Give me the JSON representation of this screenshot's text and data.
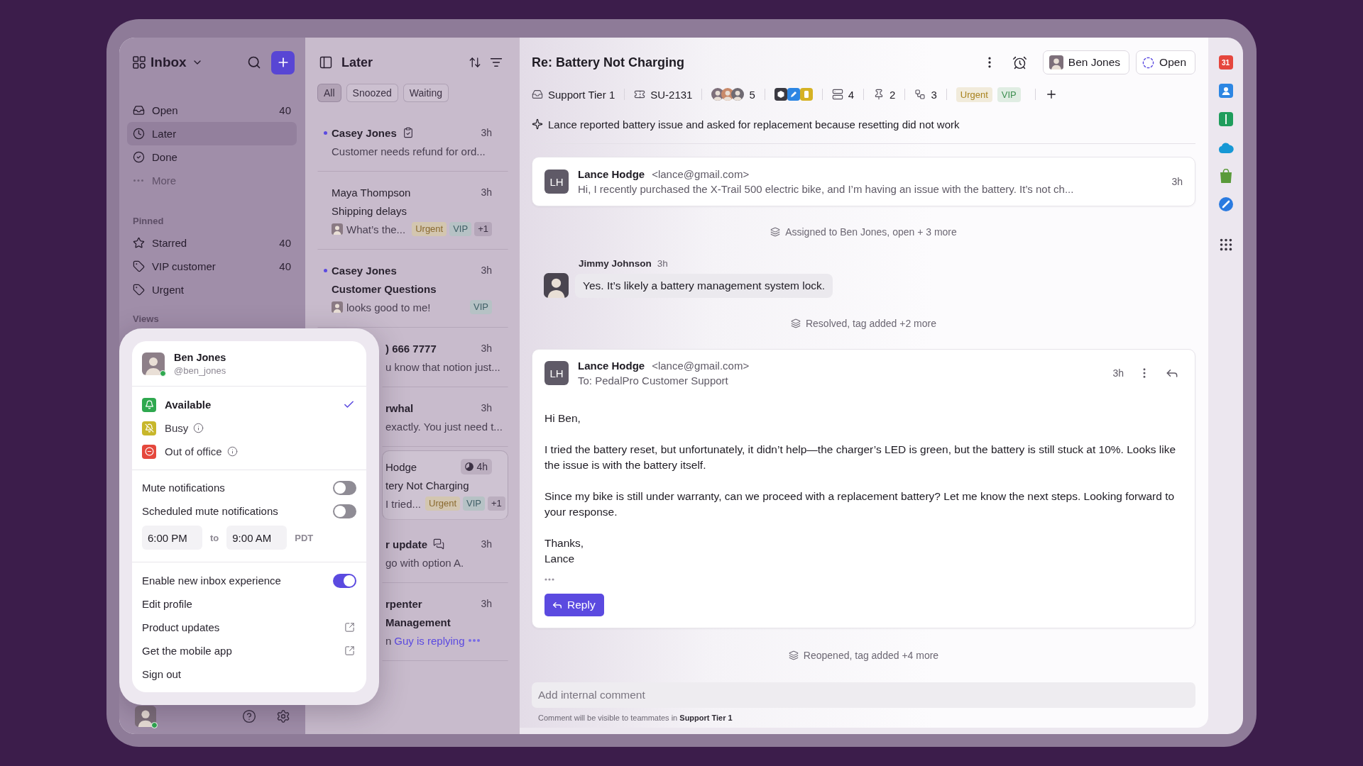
{
  "sidebar": {
    "title": "Inbox",
    "nav": [
      {
        "label": "Open",
        "count": "40",
        "selected": false
      },
      {
        "label": "Later",
        "selected": true
      },
      {
        "label": "Done",
        "selected": false
      }
    ],
    "more": "More",
    "sections": [
      {
        "title": "Pinned",
        "items": [
          {
            "kind": "starred",
            "label": "Starred",
            "count": "40"
          },
          {
            "kind": "tag",
            "label": "VIP customer",
            "count": "40"
          },
          {
            "kind": "tag",
            "label": "Urgent"
          }
        ]
      },
      {
        "title": "Views"
      }
    ]
  },
  "list": {
    "title": "Later",
    "filters": [
      {
        "label": "All",
        "selected": true
      },
      {
        "label": "Snoozed",
        "selected": false
      },
      {
        "label": "Waiting",
        "selected": false
      }
    ],
    "conversations": [
      {
        "kind": "task",
        "name": "Casey Jones",
        "unread": true,
        "selected": false,
        "time": "3h",
        "preview_avatar": false,
        "preview": "Customer needs refund for ord..."
      },
      {
        "kind": "plain",
        "name": "Maya Thompson",
        "unread": false,
        "selected": false,
        "time": "3h",
        "subject": "Shipping delays",
        "preview_avatar": true,
        "preview": "What’s the...",
        "tags": [
          {
            "label": "Urgent",
            "color": "#8a6a2f"
          },
          {
            "label": "VIP",
            "color": "#3f5f66"
          }
        ],
        "more_tags": "+1"
      },
      {
        "kind": "plain",
        "name": "Casey Jones",
        "unread": true,
        "selected": false,
        "time": "3h",
        "subject": "Customer Questions",
        "preview_avatar": true,
        "preview": "looks good to me!",
        "tags": [
          {
            "label": "VIP",
            "color": "#3f5f66"
          }
        ]
      },
      {
        "kind": "plain",
        "name": ") 666 7777",
        "unread": true,
        "selected": false,
        "time": "3h",
        "preview_avatar": false,
        "preview": "u know that notion just..."
      },
      {
        "kind": "plain",
        "name": "rwhal",
        "unread": true,
        "selected": false,
        "time": "3h",
        "preview_avatar": false,
        "preview": "exactly. You just need t..."
      },
      {
        "kind": "timer",
        "name": "Hodge",
        "unread": false,
        "selected": true,
        "time": "4h",
        "subject": "tery Not Charging",
        "preview_avatar": false,
        "preview": "I tried...",
        "tags": [
          {
            "label": "Urgent",
            "color": "#8a6a2f"
          },
          {
            "label": "VIP",
            "color": "#3f5f66"
          }
        ],
        "more_tags": "+1"
      },
      {
        "kind": "chat",
        "name": "r update",
        "unread": true,
        "selected": false,
        "time": "3h",
        "preview_avatar": false,
        "preview": "go with option A."
      },
      {
        "kind": "plain",
        "name": "rpenter",
        "unread": true,
        "selected": false,
        "time": "3h",
        "subject": "Management",
        "preview_avatar": false,
        "preview": "n",
        "typing": "Guy is replying"
      }
    ]
  },
  "conversation": {
    "title": "Re: Battery Not Charging",
    "assignee": "Ben Jones",
    "status": "Open",
    "properties": [
      {
        "kind": "inbox",
        "label": "Support Tier 1"
      },
      {
        "kind": "ticket",
        "label": "SU-2131"
      },
      {
        "kind": "people",
        "label": "5"
      },
      {
        "kind": "apps"
      },
      {
        "kind": "records",
        "label": "4"
      },
      {
        "kind": "pins",
        "label": "2"
      },
      {
        "kind": "links",
        "label": "3"
      }
    ],
    "tags": [
      {
        "label": "Urgent",
        "color": "#a8821e"
      },
      {
        "label": "VIP",
        "color": "#3f8f52"
      }
    ],
    "summary": "Lance reported battery issue and asked for replacement because resetting did not work",
    "timeline": [
      {
        "kind": "email",
        "expanded": false,
        "initials": "LH",
        "name": "Lance Hodge",
        "email": "<lance@gmail.com>",
        "preview": "Hi, I recently purchased the X-Trail 500 electric bike, and I’m having an issue with the battery. It’s not ch...",
        "time": "3h"
      },
      {
        "kind": "event",
        "text": "Assigned to Ben Jones, open + 3 more"
      },
      {
        "kind": "comment",
        "name": "Jimmy Johnson",
        "time": "3h",
        "text": "Yes. It’s likely a battery management system lock."
      },
      {
        "kind": "event",
        "text": "Resolved, tag added +2 more"
      },
      {
        "kind": "email",
        "expanded": true,
        "initials": "LH",
        "name": "Lance Hodge",
        "email": "<lance@gmail.com>",
        "to": "To: PedalPro Customer Support",
        "time": "3h",
        "body": [
          [
            "Hi Ben,"
          ],
          [
            "I tried the battery reset, but unfortunately, it didn’t help—the charger’s LED is green, but the battery is still stuck at 10%. Looks like the issue is with the battery itself."
          ],
          [
            "Since my bike is still under warranty, can we proceed with a replacement battery? Let me know the next steps. Looking forward to your response."
          ],
          [
            "Thanks,",
            "Lance"
          ]
        ],
        "reply": "Reply"
      },
      {
        "kind": "event",
        "text": "Reopened, tag added +4 more"
      }
    ],
    "comment_box": {
      "placeholder": "Add internal comment",
      "note": "Comment will be visible to teammates in **Support Tier 1**"
    }
  },
  "rail": {
    "apps": [
      {
        "kind": "calendar",
        "label": "31"
      },
      {
        "kind": "contacts"
      },
      {
        "kind": "sheets"
      },
      {
        "kind": "cloud"
      },
      {
        "kind": "store"
      },
      {
        "kind": "compass"
      },
      {
        "kind": "launcher"
      }
    ]
  },
  "profile_menu": {
    "name": "Ben Jones",
    "handle": "@ben_jones",
    "online": true,
    "statuses": [
      {
        "kind": "available",
        "label": "Available",
        "color": "#2fa84f",
        "selected": true,
        "info": false
      },
      {
        "kind": "busy",
        "label": "Busy",
        "color": "#c8b72b",
        "selected": false,
        "info": true
      },
      {
        "kind": "away",
        "label": "Out of office",
        "color": "#e5483d",
        "selected": false,
        "info": true
      }
    ],
    "toggles": [
      {
        "label": "Mute notifications",
        "on": false
      },
      {
        "label": "Scheduled mute notifications",
        "on": false
      }
    ],
    "schedule": {
      "from": "6:00 PM",
      "separator": "to",
      "until": "9:00 AM",
      "timezone": "PDT"
    },
    "items": [
      {
        "kind": "toggle",
        "label": "Enable new inbox experience",
        "on": true
      },
      {
        "kind": "link",
        "label": "Edit profile"
      },
      {
        "kind": "external",
        "label": "Product updates"
      },
      {
        "kind": "external",
        "label": "Get the mobile app"
      },
      {
        "kind": "link",
        "label": "Sign out"
      }
    ]
  }
}
